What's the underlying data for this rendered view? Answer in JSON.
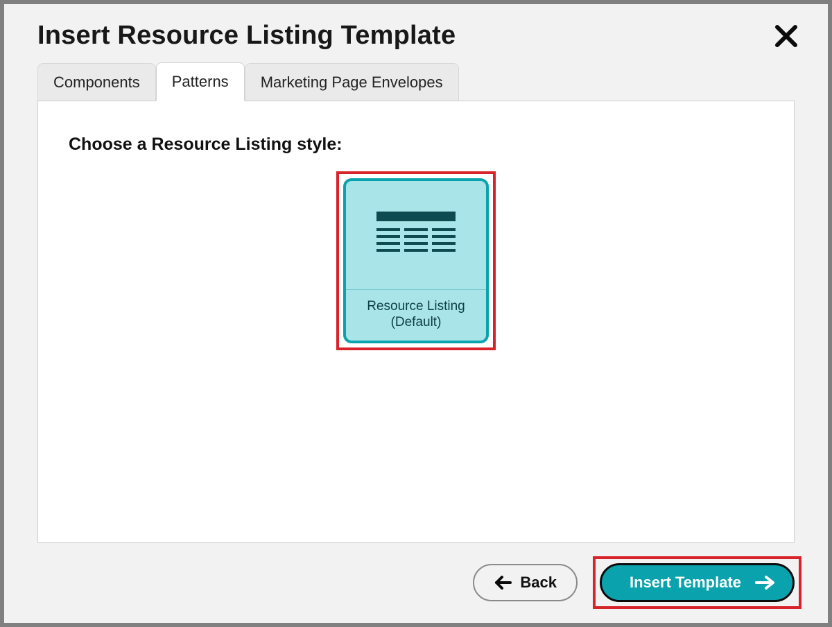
{
  "dialog": {
    "title": "Insert Resource Listing Template"
  },
  "tabs": {
    "components": "Components",
    "patterns": "Patterns",
    "marketing": "Marketing Page Envelopes",
    "active": "patterns"
  },
  "panel": {
    "heading": "Choose a Resource Listing style:"
  },
  "templates": {
    "resource_listing_default": {
      "line1": "Resource Listing",
      "line2": "(Default)"
    }
  },
  "footer": {
    "back_label": "Back",
    "insert_label": "Insert Template"
  }
}
